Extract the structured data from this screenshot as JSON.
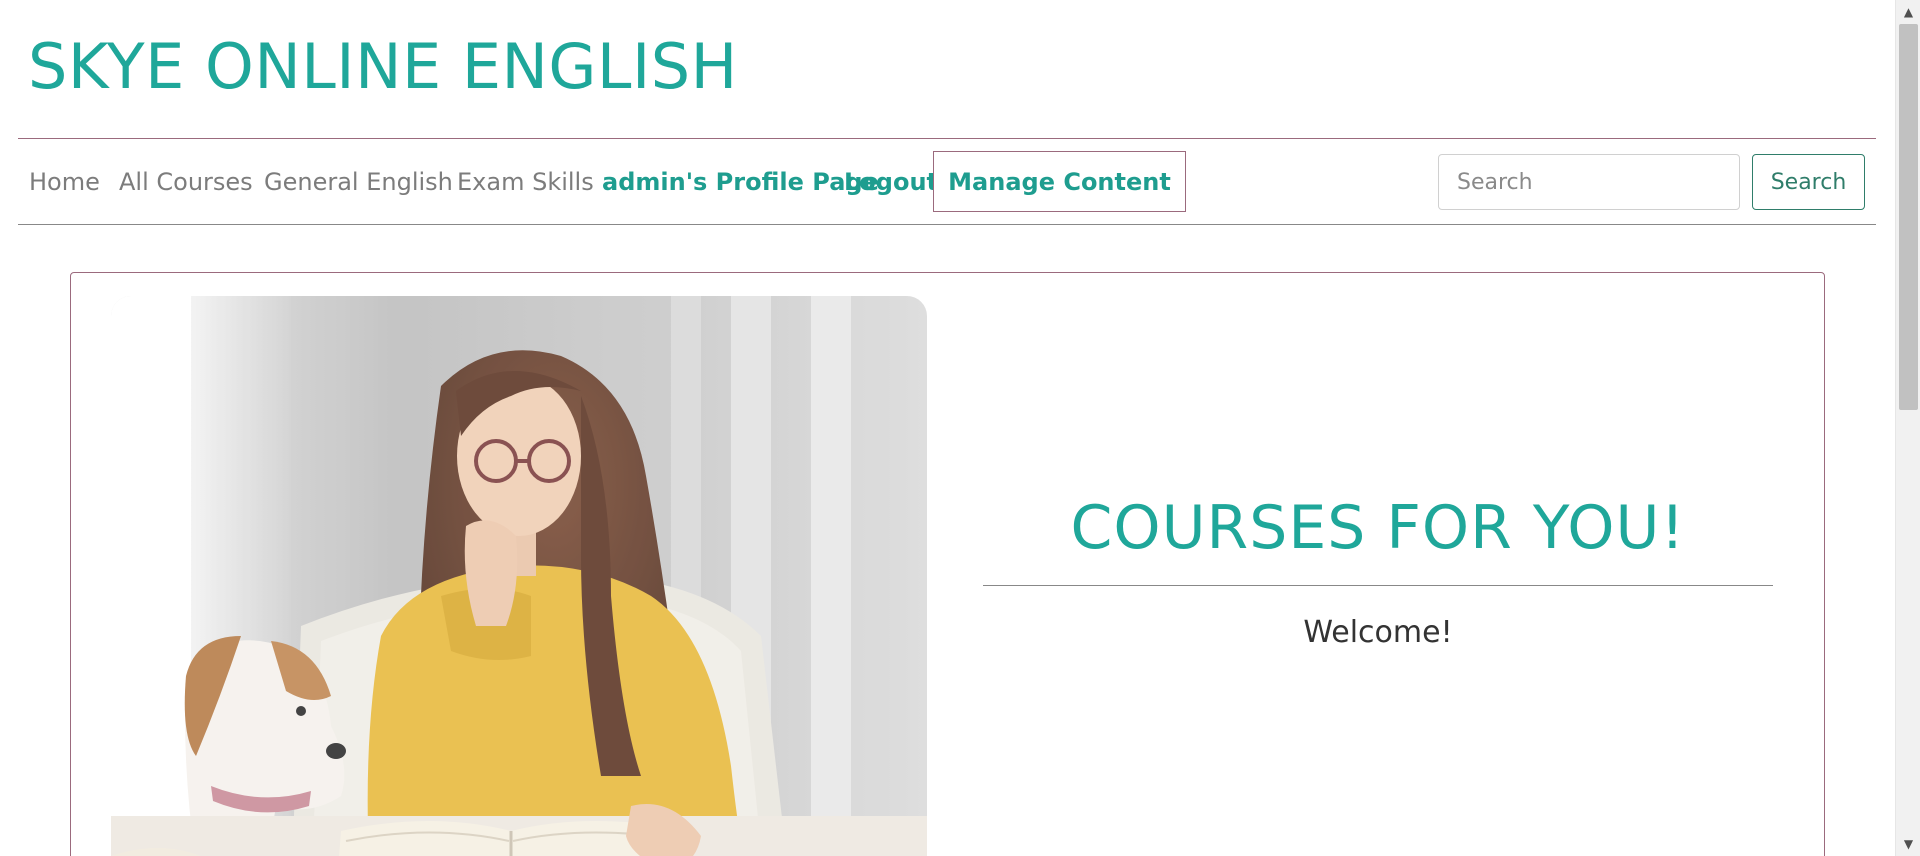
{
  "header": {
    "site_title": "SKYE ONLINE ENGLISH"
  },
  "nav": {
    "items": [
      {
        "label": "Home"
      },
      {
        "label": "All Courses"
      },
      {
        "label": "General English"
      },
      {
        "label": "Exam Skills"
      },
      {
        "label": "admin's Profile Page"
      },
      {
        "label": "Logout"
      }
    ],
    "manage_label": "Manage Content",
    "search_placeholder": "Search",
    "search_button": "Search"
  },
  "hero": {
    "headline": "COURSES FOR YOU!",
    "welcome": "Welcome!"
  },
  "scrollbar": {
    "up_glyph": "▲",
    "down_glyph": "▼"
  },
  "colors": {
    "accent": "#1fa79a",
    "border": "#9b6a7d",
    "search_button": "#2f7d6a"
  }
}
